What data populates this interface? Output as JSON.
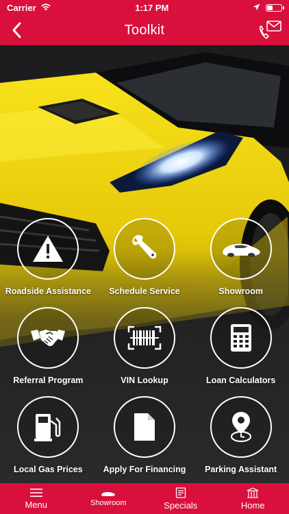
{
  "status_bar": {
    "carrier": "Carrier",
    "time": "1:17 PM",
    "icons": [
      "wifi-icon",
      "location-arrow-icon",
      "battery-icon"
    ],
    "battery_level": 0.35
  },
  "nav": {
    "title": "Toolkit",
    "back_icon": "chevron-left-icon",
    "contact_icon": "phone-mail-icon"
  },
  "tools": [
    {
      "label": "Roadside Assistance",
      "icon": "warning-triangle-icon"
    },
    {
      "label": "Schedule Service",
      "icon": "wrench-icon"
    },
    {
      "label": "Showroom",
      "icon": "car-icon"
    },
    {
      "label": "Referral Program",
      "icon": "handshake-icon"
    },
    {
      "label": "VIN Lookup",
      "icon": "barcode-scan-icon"
    },
    {
      "label": "Loan Calculators",
      "icon": "calculator-icon"
    },
    {
      "label": "Local Gas Prices",
      "icon": "gas-pump-icon"
    },
    {
      "label": "Apply For Financing",
      "icon": "document-icon"
    },
    {
      "label": "Parking Assistant",
      "icon": "map-pin-clock-icon"
    }
  ],
  "tabs": [
    {
      "label": "Menu",
      "icon": "hamburger-icon"
    },
    {
      "label": "Showroom",
      "icon": "car-icon"
    },
    {
      "label": "Specials",
      "icon": "tag-list-icon"
    },
    {
      "label": "Home",
      "icon": "building-icon"
    }
  ],
  "colors": {
    "brand_red": "#d90f3c",
    "hero_car_yellow": "#f2d90f"
  }
}
